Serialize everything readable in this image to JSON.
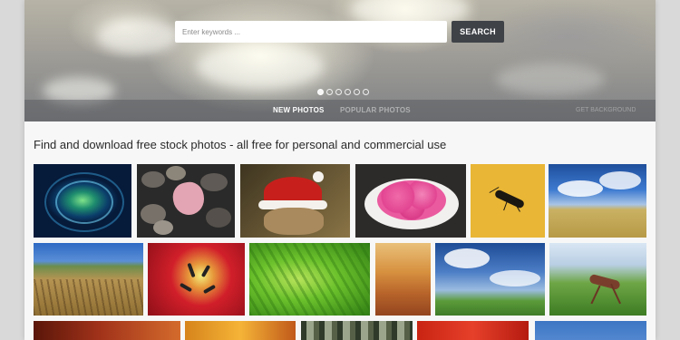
{
  "search": {
    "placeholder": "Enter keywords ...",
    "button_label": "SEARCH"
  },
  "slider": {
    "dot_count": 6,
    "active_index": 0
  },
  "nav": {
    "tabs": [
      {
        "label": "NEW PHOTOS",
        "active": true
      },
      {
        "label": "POPULAR PHOTOS",
        "active": false
      }
    ],
    "extra_label": "GET BACKGROUND"
  },
  "tagline": "Find and download free stock photos - all free for personal and commercial use",
  "photos": [
    {
      "subject": "water-ripple"
    },
    {
      "subject": "heart-pebbles"
    },
    {
      "subject": "dog-santa-hat"
    },
    {
      "subject": "pink-flowers-bowl"
    },
    {
      "subject": "wasp-yellow"
    },
    {
      "subject": "wheat-field-sky"
    },
    {
      "subject": "wheat-close"
    },
    {
      "subject": "red-tulip"
    },
    {
      "subject": "green-fern"
    },
    {
      "subject": "autumn-field"
    },
    {
      "subject": "field-clouds"
    },
    {
      "subject": "grasshopper"
    },
    {
      "subject": "sunset-trees"
    },
    {
      "subject": "orange-glow"
    },
    {
      "subject": "forest-trunks"
    },
    {
      "subject": "red-abstract"
    },
    {
      "subject": "blue-sky"
    }
  ],
  "colors": {
    "search_button": "#3f4247",
    "page_background": "#f7f7f7"
  }
}
